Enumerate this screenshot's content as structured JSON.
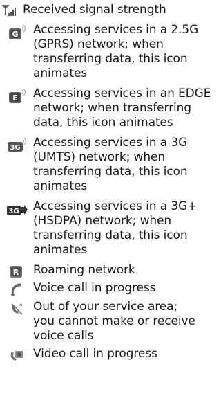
{
  "items": [
    {
      "icon": "signal-strength-icon",
      "text": "Received signal strength"
    },
    {
      "icon": "gprs-network-icon",
      "text": "Accessing services in a 2.5G (GPRS) network; when transferring data, this icon animates"
    },
    {
      "icon": "edge-network-icon",
      "text": "Accessing services in an EDGE network; when transferring data, this icon animates"
    },
    {
      "icon": "umts-3g-network-icon",
      "text": "Accessing services in a 3G (UMTS) network; when transferring data, this icon animates"
    },
    {
      "icon": "hsdpa-3g-plus-network-icon",
      "text": "Accessing services in a 3G+ (HSDPA) network; when transferring data, this icon animates"
    },
    {
      "icon": "roaming-network-icon",
      "text": "Roaming network"
    },
    {
      "icon": "voice-call-icon",
      "text": "Voice call in progress"
    },
    {
      "icon": "no-service-icon",
      "text": "Out of your service area; you cannot make or receive voice calls"
    },
    {
      "icon": "video-call-icon",
      "text": "Video call in progress"
    }
  ]
}
